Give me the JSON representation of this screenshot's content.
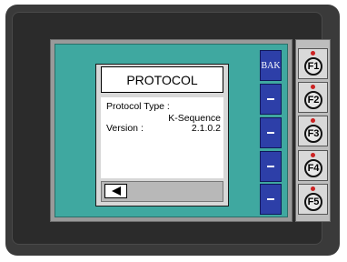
{
  "dialog": {
    "title": "PROTOCOL",
    "protocol_type_label": "Protocol Type :",
    "protocol_type_value": "K-Sequence",
    "version_label": "Version :",
    "version_value": "2.1.0.2",
    "back_icon": "left-arrow-icon"
  },
  "softkeys": [
    {
      "label": "BAK"
    },
    {
      "label": ""
    },
    {
      "label": ""
    },
    {
      "label": ""
    },
    {
      "label": ""
    }
  ],
  "function_keys": [
    {
      "label": "F1"
    },
    {
      "label": "F2"
    },
    {
      "label": "F3"
    },
    {
      "label": "F4"
    },
    {
      "label": "F5"
    }
  ],
  "colors": {
    "screen": "#3fa8a0",
    "softkey": "#2d3fa8",
    "housing": "#3a3a3a",
    "led": "#cc2222"
  }
}
